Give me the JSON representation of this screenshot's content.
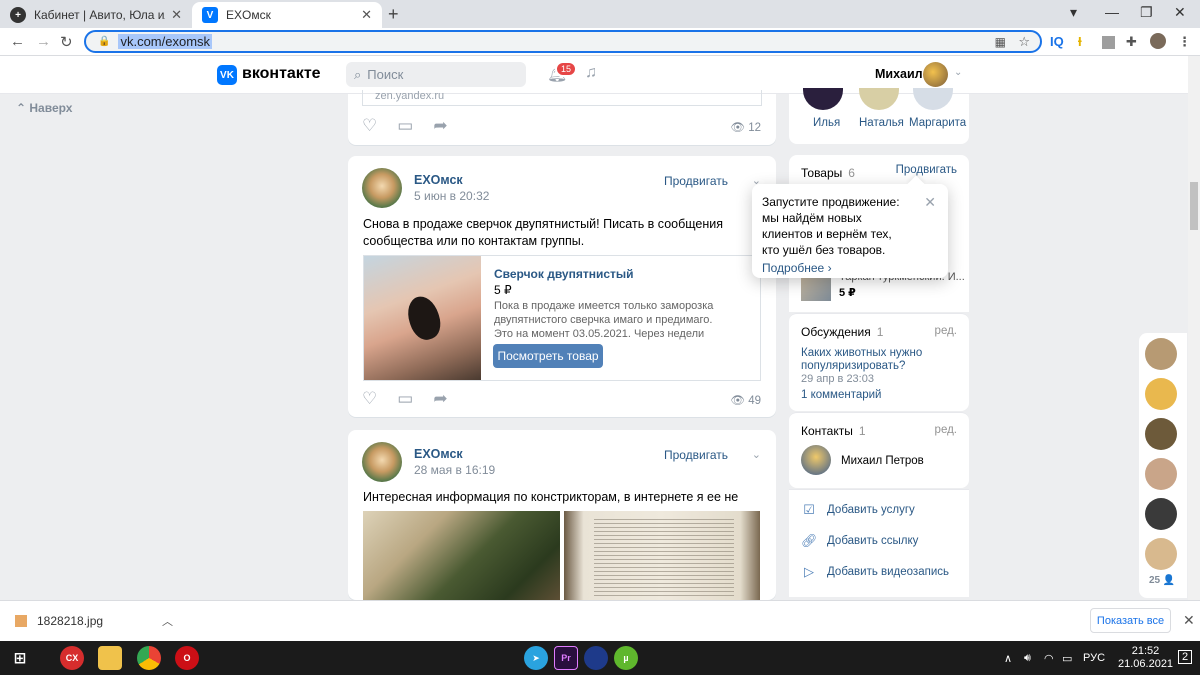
{
  "browser": {
    "tabs": [
      {
        "title": "Кабинет | Авито, Юла или Вк? К"
      },
      {
        "title": "EXOмск"
      }
    ],
    "url": "vk.com/exomsk",
    "ext_iq": "IQ"
  },
  "header": {
    "logo_text": "вконтакте",
    "search_placeholder": "Поиск",
    "notif_count": "15",
    "username": "Михаил"
  },
  "up_button": "Наверх",
  "top_post": {
    "link_preview": "zen.yandex.ru",
    "views": "12"
  },
  "posts": [
    {
      "author": "EXOмск",
      "date": "5 июн в 20:32",
      "promote": "Продвигать",
      "text": "Снова в продаже сверчок двупятнистый! Писать в сообщения сообщества или по контактам группы.",
      "product": {
        "title": "Сверчок двупятнистый",
        "price": "5 ₽",
        "description": "Пока в продаже имеется только заморозка двупятнистого сверчка имаго и предимаго. Это на момент 03.05.2021. Через недели две-три пыль..",
        "button": "Посмотреть товар"
      },
      "views": "49"
    },
    {
      "author": "EXOмск",
      "date": "28 мая в 16:19",
      "promote": "Продвигать",
      "text": "Интересная информация по констрикторам, в интернете я ее не видел."
    }
  ],
  "sidebar": {
    "friends": [
      "Илья",
      "Наталья",
      "Маргарита"
    ],
    "goods": {
      "title": "Товары",
      "count": "6",
      "promote": "Продвигать",
      "item_title": "Таркан туркменский. И...",
      "item_price": "5 ₽"
    },
    "discussions": {
      "title": "Обсуждения",
      "count": "1",
      "edit": "ред.",
      "topic": "Каких животных нужно популяризировать?",
      "date": "29 апр в 23:03",
      "comments": "1 комментарий"
    },
    "contacts": {
      "title": "Контакты",
      "count": "1",
      "edit": "ред.",
      "name": "Михаил Петров"
    },
    "add": [
      "Добавить услугу",
      "Добавить ссылку",
      "Добавить видеозапись"
    ]
  },
  "tooltip": {
    "text": "Запустите продвижение: мы найдём новых клиентов и вернём тех, кто ушёл без товаров.",
    "more": "Подробнее"
  },
  "chat_count": "25",
  "downloads": {
    "file": "1828218.jpg",
    "show_all": "Показать все"
  },
  "taskbar": {
    "lang": "РУС",
    "time": "21:52",
    "date": "21.06.2021",
    "notif": "2"
  }
}
